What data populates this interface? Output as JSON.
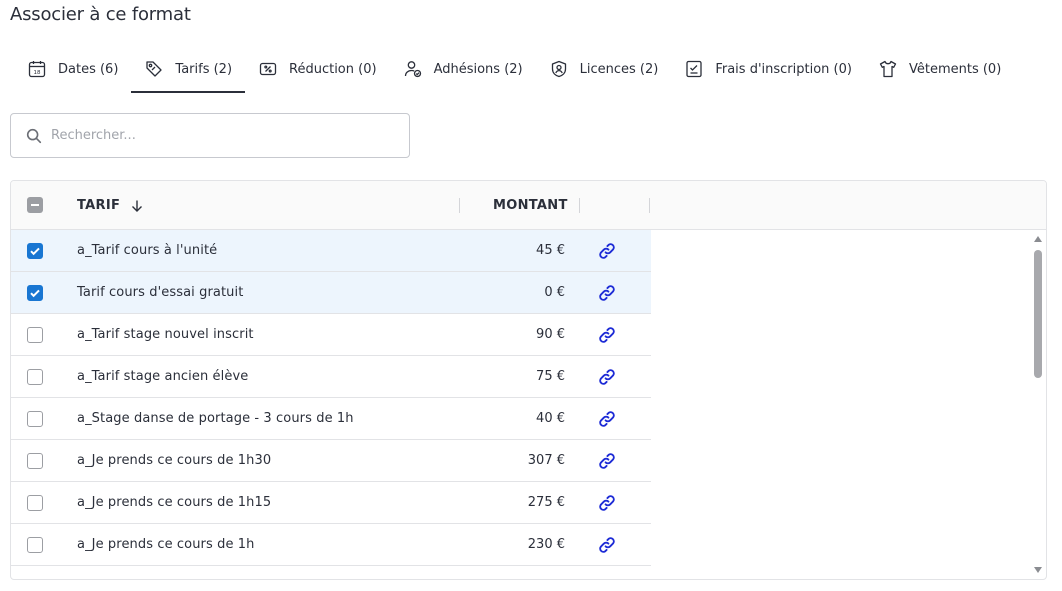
{
  "page": {
    "title": "Associer à ce format"
  },
  "tabs": [
    {
      "label": "Dates (6)",
      "icon": "calendar-icon",
      "active": false
    },
    {
      "label": "Tarifs (2)",
      "icon": "tag-icon",
      "active": true
    },
    {
      "label": "Réduction (0)",
      "icon": "discount-ticket-icon",
      "active": false
    },
    {
      "label": "Adhésions (2)",
      "icon": "user-check-icon",
      "active": false
    },
    {
      "label": "Licences (2)",
      "icon": "badge-icon",
      "active": false
    },
    {
      "label": "Frais d'inscription (0)",
      "icon": "signature-icon",
      "active": false
    },
    {
      "label": "Vêtements (0)",
      "icon": "tshirt-icon",
      "active": false
    }
  ],
  "search": {
    "placeholder": "Rechercher..."
  },
  "table": {
    "columns": {
      "tarif": "TARIF",
      "montant": "MONTANT"
    },
    "rows": [
      {
        "label": "a_Tarif cours à l'unité",
        "amount": "45 €",
        "checked": true
      },
      {
        "label": "Tarif cours d'essai gratuit",
        "amount": "0 €",
        "checked": true
      },
      {
        "label": "a_Tarif stage nouvel inscrit",
        "amount": "90 €",
        "checked": false
      },
      {
        "label": "a_Tarif stage ancien élève",
        "amount": "75 €",
        "checked": false
      },
      {
        "label": "a_Stage danse de portage - 3 cours de 1h",
        "amount": "40 €",
        "checked": false
      },
      {
        "label": "a_Je prends ce cours de 1h30",
        "amount": "307 €",
        "checked": false
      },
      {
        "label": "a_Je prends ce cours de 1h15",
        "amount": "275 €",
        "checked": false
      },
      {
        "label": "a_Je prends ce cours de 1h",
        "amount": "230 €",
        "checked": false
      }
    ]
  },
  "colors": {
    "accent": "#1976d2",
    "link": "#1d2bd6",
    "selected_row": "#edf5fd"
  }
}
